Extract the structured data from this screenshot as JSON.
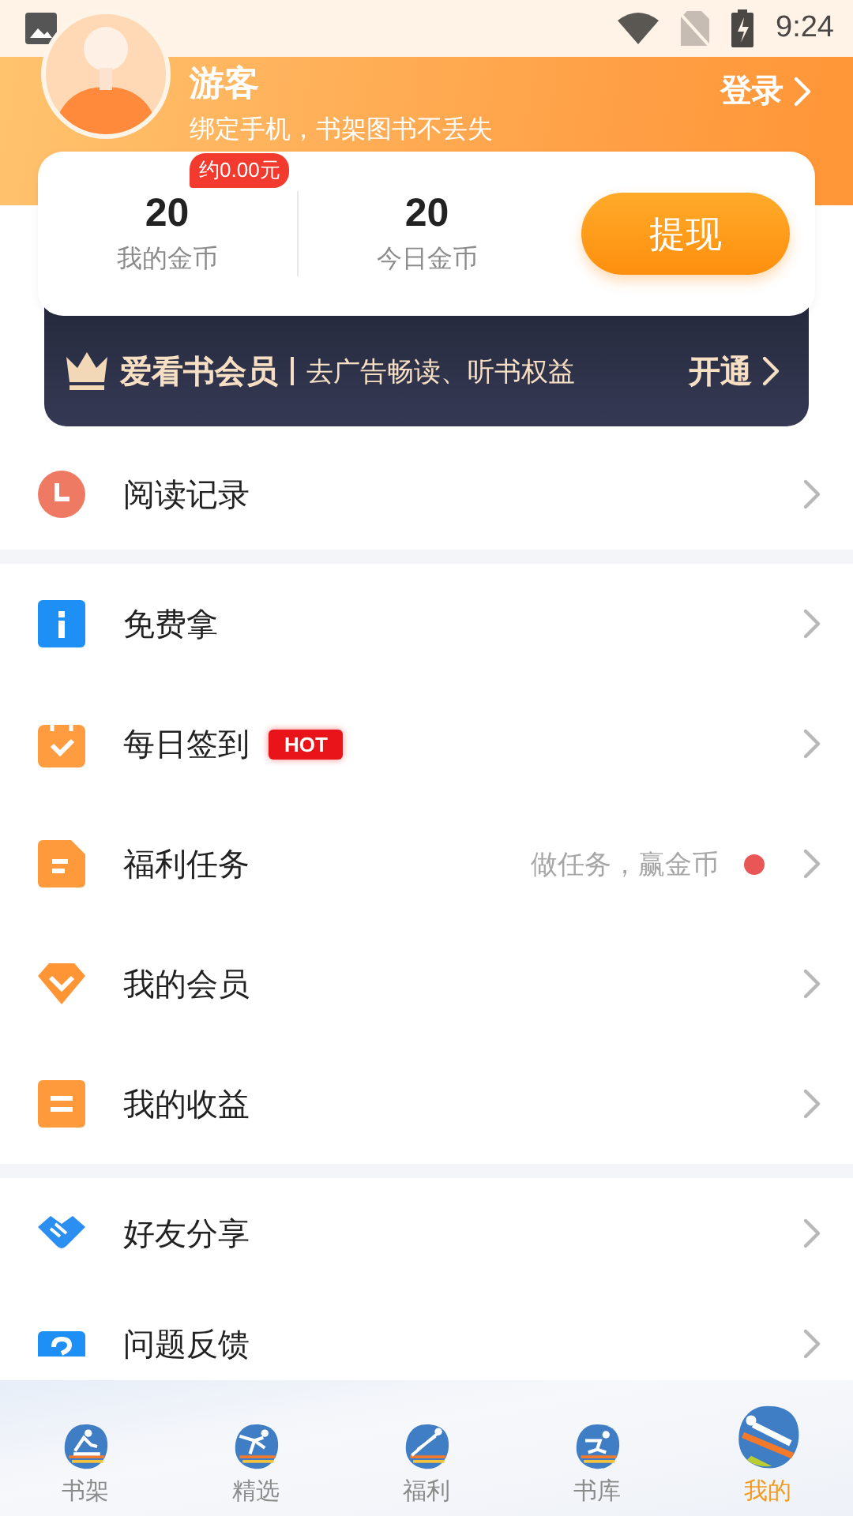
{
  "status_bar": {
    "time": "9:24"
  },
  "profile": {
    "name": "游客",
    "subtitle": "绑定手机，书架图书不丢失",
    "login": "登录"
  },
  "coins": {
    "stats": [
      {
        "value": "20",
        "label": "我的金币",
        "badge": "约0.00元"
      },
      {
        "value": "20",
        "label": "今日金币"
      }
    ],
    "withdraw": "提现"
  },
  "vip": {
    "title": "爱看书会员",
    "subtitle": "去广告畅读、听书权益",
    "action": "开通"
  },
  "menu_groups": [
    [
      {
        "kind": "clock",
        "label": "阅读记录"
      }
    ],
    [
      {
        "kind": "info",
        "label": "免费拿"
      },
      {
        "kind": "calendar",
        "label": "每日签到",
        "tag": "HOT"
      },
      {
        "kind": "doc",
        "label": "福利任务",
        "hint": "做任务，赢金币",
        "dot": true
      },
      {
        "kind": "diamond",
        "label": "我的会员"
      },
      {
        "kind": "note",
        "label": "我的收益"
      }
    ],
    [
      {
        "kind": "handshake",
        "label": "好友分享"
      },
      {
        "kind": "question",
        "label": "问题反馈"
      }
    ]
  ],
  "tabs": [
    {
      "kind": "skier",
      "label": "书架",
      "selected": false
    },
    {
      "kind": "skater",
      "label": "精选",
      "selected": false
    },
    {
      "kind": "jumper",
      "label": "福利",
      "selected": false
    },
    {
      "kind": "speed",
      "label": "书库",
      "selected": false
    },
    {
      "kind": "luge",
      "label": "我的",
      "selected": true
    }
  ]
}
